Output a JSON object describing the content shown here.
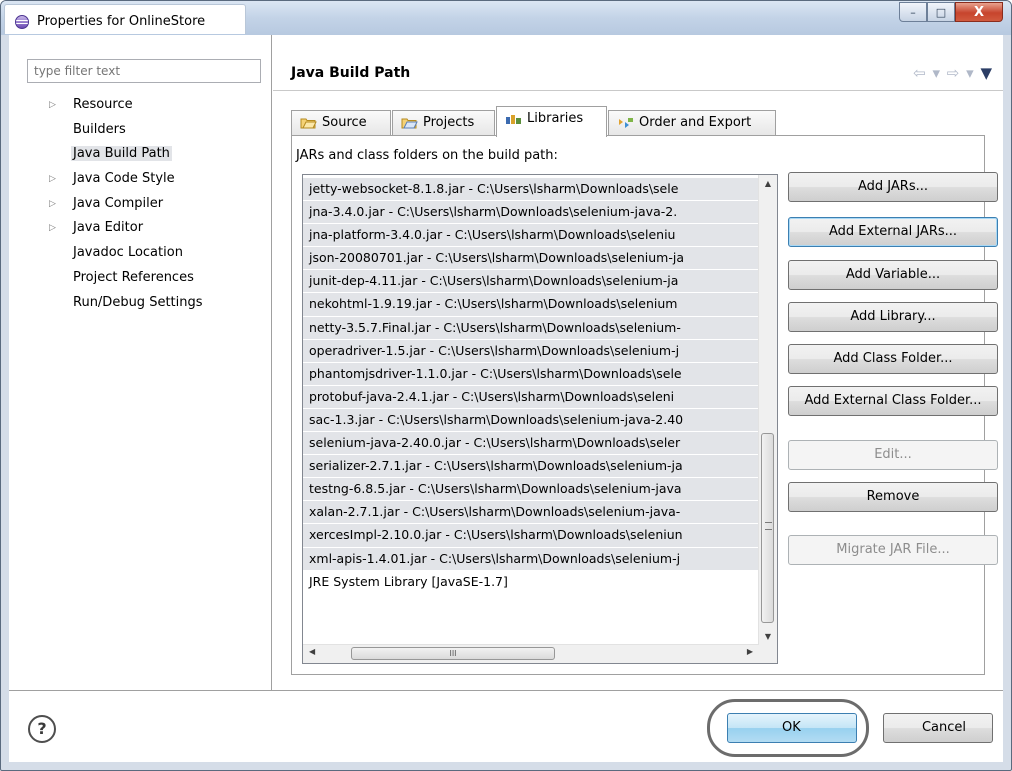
{
  "window": {
    "title": "Properties for OnlineStore",
    "controls": {
      "minimize": "–",
      "maximize": "□",
      "close": "X"
    }
  },
  "sidebar": {
    "filter_placeholder": "type filter text",
    "items": [
      {
        "label": "Resource",
        "expandable": true
      },
      {
        "label": "Builders",
        "expandable": false
      },
      {
        "label": "Java Build Path",
        "expandable": false,
        "selected": true
      },
      {
        "label": "Java Code Style",
        "expandable": true
      },
      {
        "label": "Java Compiler",
        "expandable": true
      },
      {
        "label": "Java Editor",
        "expandable": true
      },
      {
        "label": "Javadoc Location",
        "expandable": false
      },
      {
        "label": "Project References",
        "expandable": false
      },
      {
        "label": "Run/Debug Settings",
        "expandable": false
      }
    ]
  },
  "page": {
    "title": "Java Build Path",
    "nav": {
      "back": "⇦",
      "forward": "⇨",
      "dropdown": "▾",
      "menu": "▼"
    }
  },
  "tabs": [
    {
      "label": "Source",
      "icon": "source-folder-icon",
      "active": false
    },
    {
      "label": "Projects",
      "icon": "projects-folder-icon",
      "active": false
    },
    {
      "label": "Libraries",
      "icon": "libraries-icon",
      "active": true
    },
    {
      "label": "Order and Export",
      "icon": "order-export-icon",
      "active": false
    }
  ],
  "libraries": {
    "caption": "JARs and class folders on the build path:",
    "entries": [
      "jetty-websocket-8.1.8.jar - C:\\Users\\lsharm\\Downloads\\sele",
      "jna-3.4.0.jar - C:\\Users\\lsharm\\Downloads\\selenium-java-2.",
      "jna-platform-3.4.0.jar - C:\\Users\\lsharm\\Downloads\\seleniu",
      "json-20080701.jar - C:\\Users\\lsharm\\Downloads\\selenium-ja",
      "junit-dep-4.11.jar - C:\\Users\\lsharm\\Downloads\\selenium-ja",
      "nekohtml-1.9.19.jar - C:\\Users\\lsharm\\Downloads\\selenium",
      "netty-3.5.7.Final.jar - C:\\Users\\lsharm\\Downloads\\selenium-",
      "operadriver-1.5.jar - C:\\Users\\lsharm\\Downloads\\selenium-j",
      "phantomjsdriver-1.1.0.jar - C:\\Users\\lsharm\\Downloads\\sele",
      "protobuf-java-2.4.1.jar - C:\\Users\\lsharm\\Downloads\\seleni",
      "sac-1.3.jar - C:\\Users\\lsharm\\Downloads\\selenium-java-2.40",
      "selenium-java-2.40.0.jar - C:\\Users\\lsharm\\Downloads\\seler",
      "serializer-2.7.1.jar - C:\\Users\\lsharm\\Downloads\\selenium-ja",
      "testng-6.8.5.jar - C:\\Users\\lsharm\\Downloads\\selenium-java",
      "xalan-2.7.1.jar - C:\\Users\\lsharm\\Downloads\\selenium-java-",
      "xercesImpl-2.10.0.jar - C:\\Users\\lsharm\\Downloads\\seleniun",
      "xml-apis-1.4.01.jar - C:\\Users\\lsharm\\Downloads\\selenium-j",
      "JRE System Library [JavaSE-1.7]"
    ],
    "selected_count": 17,
    "scroll": {
      "up": "▲",
      "down": "▼",
      "left": "◀",
      "right": "▶",
      "thumb_grip": "III"
    }
  },
  "buttons": {
    "add_jars": "Add JARs...",
    "add_external_jars": "Add External JARs...",
    "add_variable": "Add Variable...",
    "add_library": "Add Library...",
    "add_class_folder": "Add Class Folder...",
    "add_external_class_folder": "Add External Class Folder...",
    "edit": "Edit...",
    "remove": "Remove",
    "migrate_jar": "Migrate JAR File..."
  },
  "footer": {
    "help": "?",
    "ok": "OK",
    "cancel": "Cancel"
  },
  "colors": {
    "selection": "#e2e4e8",
    "focus_border": "#3c7fb1",
    "ok_highlight": "#98d1ef"
  }
}
